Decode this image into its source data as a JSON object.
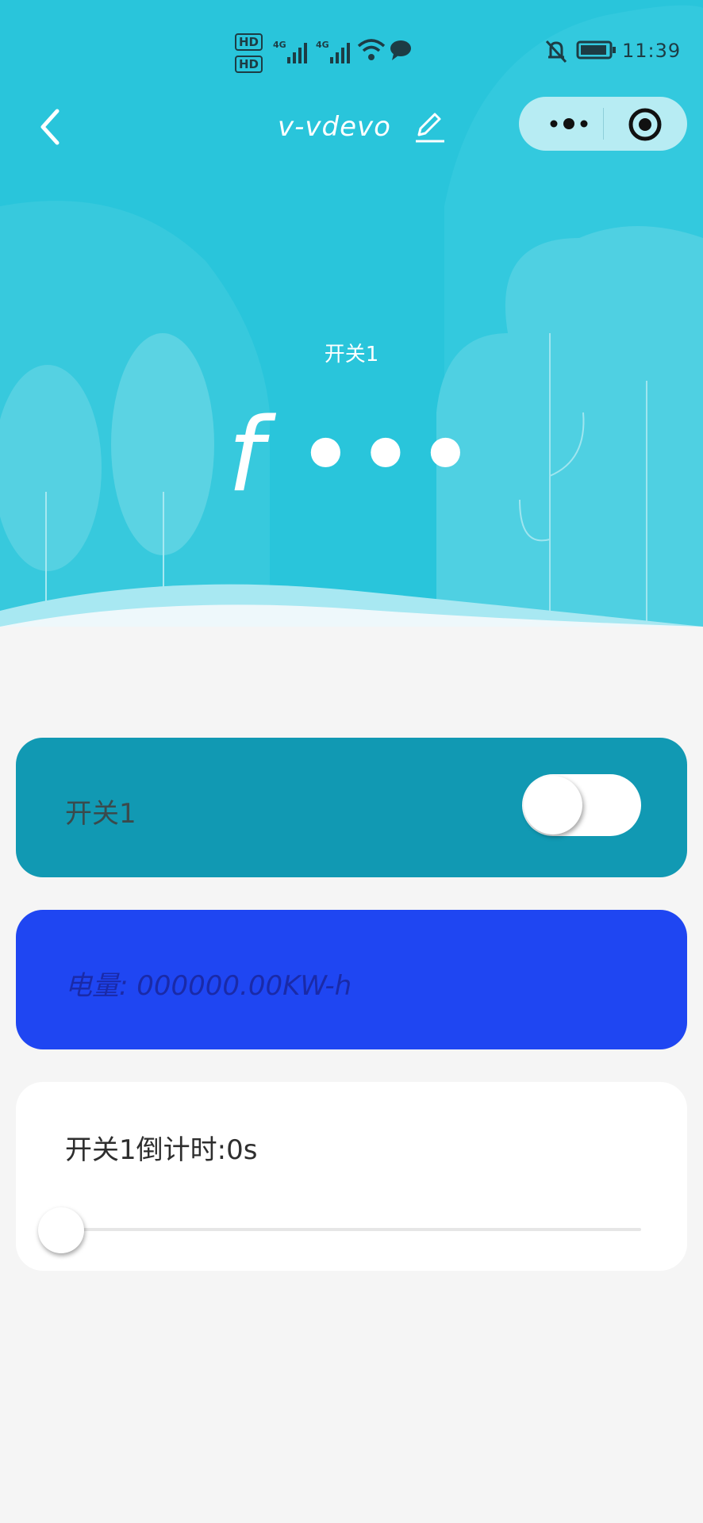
{
  "status_bar": {
    "hd1": "HD",
    "hd2": "HD",
    "net1": "4G",
    "net2": "4G",
    "time": "11:39"
  },
  "nav": {
    "title": "v-vdevo"
  },
  "hero": {
    "label": "开关1",
    "value": "f •••"
  },
  "cards": {
    "switch_label": "开关1",
    "switch_on": false,
    "power_label": "电量: 000000.00KW-h",
    "timer_label": "开关1倒计时:0s",
    "timer_value": 0
  },
  "colors": {
    "hero_bg": "#29c5db",
    "switch_card": "#1199b3",
    "power_card": "#1f46f2",
    "page_bg": "#f5f5f5"
  }
}
